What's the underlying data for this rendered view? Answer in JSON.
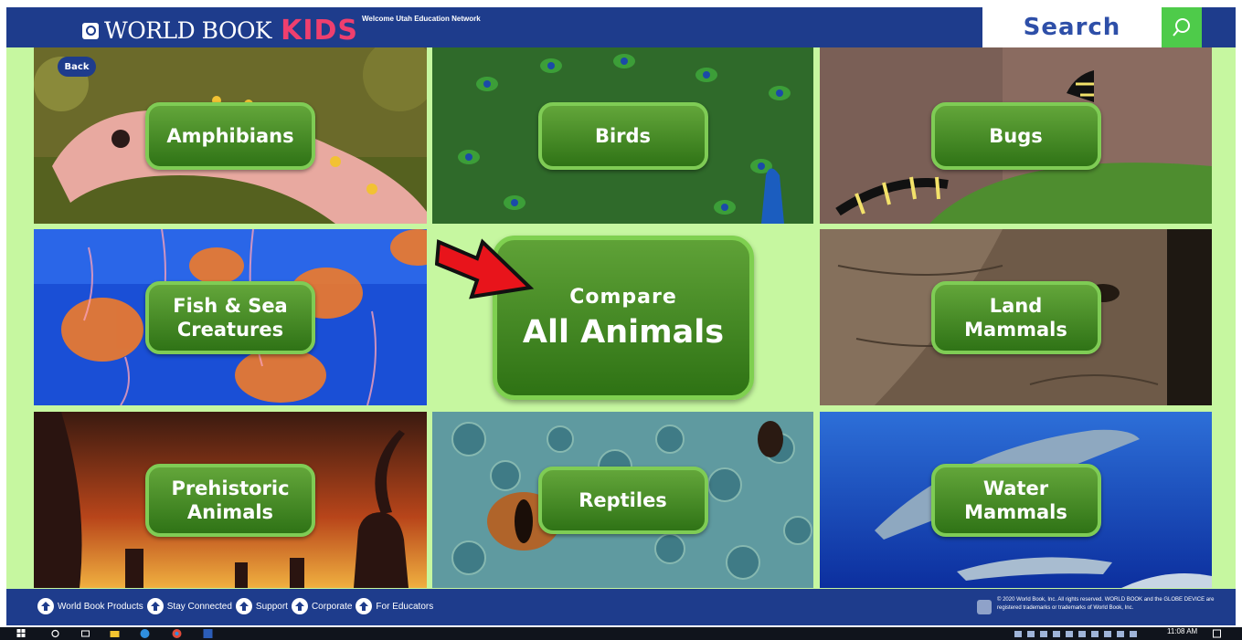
{
  "header": {
    "brand_main": "WORLD BOOK",
    "brand_kids": "KIDS",
    "welcome": "Welcome Utah Education Network",
    "search_label": "Search"
  },
  "back_label": "Back",
  "categories": [
    {
      "id": "amphibians",
      "label": "Amphibians"
    },
    {
      "id": "birds",
      "label": "Birds"
    },
    {
      "id": "bugs",
      "label": "Bugs"
    },
    {
      "id": "fish",
      "label": "Fish & Sea\nCreatures"
    },
    {
      "id": "land-mammals",
      "label": "Land\nMammals"
    },
    {
      "id": "prehistoric",
      "label": "Prehistoric\nAnimals"
    },
    {
      "id": "reptiles",
      "label": "Reptiles"
    },
    {
      "id": "water-mammals",
      "label": "Water\nMammals"
    }
  ],
  "compare": {
    "line1": "Compare",
    "line2": "All Animals"
  },
  "footer": {
    "links": [
      "World Book Products",
      "Stay Connected",
      "Support",
      "Corporate",
      "For Educators"
    ],
    "copyright": "© 2020 World Book, Inc. All rights reserved. WORLD BOOK and the GLOBE DEVICE are registered trademarks or trademarks of World Book, Inc."
  },
  "taskbar": {
    "clock": "11:08 AM"
  },
  "colors": {
    "header_blue": "#1e3c8c",
    "kids_pink": "#ef3f6e",
    "search_green": "#4ecb4a",
    "background_green": "#c6f7a0",
    "button_green": "#3f8a22",
    "arrow_red": "#e8141b"
  }
}
